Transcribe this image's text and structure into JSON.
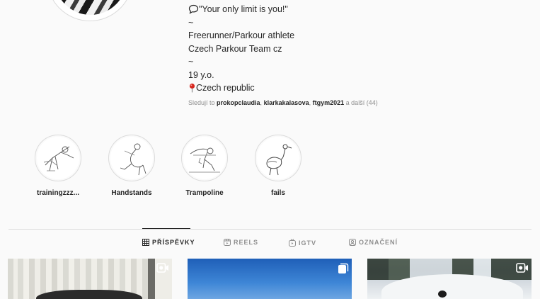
{
  "profile": {
    "avatar_alt": "profile picture"
  },
  "bio": {
    "quote": "\"Your only limit is you!\"",
    "sep1": "~",
    "role": "Freerunner/Parkour athlete",
    "team": "Czech Parkour Team cz",
    "sep2": "~",
    "age": "19 y.o.",
    "location": "Czech republic"
  },
  "followed_by": {
    "prefix": "Sledují to ",
    "user1": "prokopclaudia",
    "comma1": ", ",
    "user2": "klarkakalasova",
    "comma2": ", ",
    "user3": "ftgym2021",
    "suffix": " a další (44)"
  },
  "highlights": [
    {
      "label": "trainingzzz...",
      "icon": "handstand-drawing"
    },
    {
      "label": "Handstands",
      "icon": "backbend-drawing"
    },
    {
      "label": "Trampoline",
      "icon": "trampoline-drawing"
    },
    {
      "label": "fails",
      "icon": "ostrich-drawing"
    }
  ],
  "tabs": [
    {
      "label": "PŘÍSPĚVKY",
      "icon": "grid-icon",
      "active": true
    },
    {
      "label": "REELS",
      "icon": "reels-icon",
      "active": false
    },
    {
      "label": "IGTV",
      "icon": "igtv-icon",
      "active": false
    },
    {
      "label": "OZNAČENÍ",
      "icon": "tagged-icon",
      "active": false
    }
  ],
  "posts": [
    {
      "type": "video",
      "icon": "video-camera-icon"
    },
    {
      "type": "carousel",
      "icon": "multiple-photos-icon"
    },
    {
      "type": "video",
      "icon": "video-camera-icon"
    }
  ],
  "colors": {
    "background": "#fafafa",
    "text": "#262626",
    "muted": "#8e8e8e",
    "border": "#dbdbdb"
  }
}
